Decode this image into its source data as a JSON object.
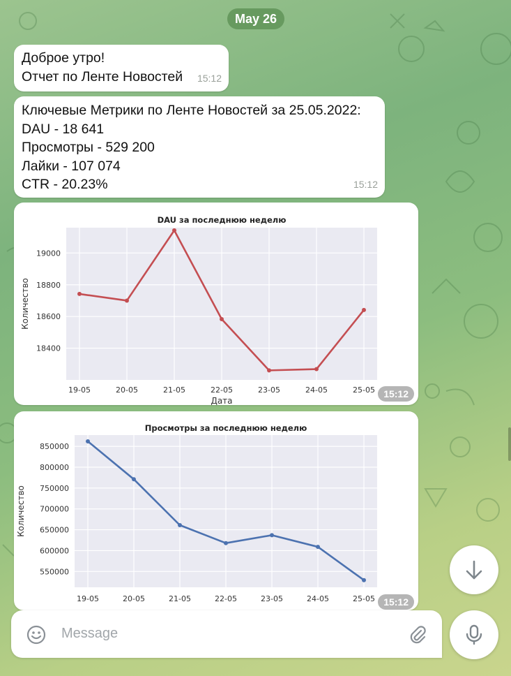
{
  "date_pill": "May 26",
  "messages": [
    {
      "lines": [
        "Доброе утро!",
        "Отчет по Ленте Новостей"
      ],
      "time": "15:12"
    },
    {
      "lines": [
        "Ключевые Метрики по Ленте Новостей за 25.05.2022:",
        "DAU - 18 641",
        "Просмотры - 529 200",
        "Лайки - 107 074",
        "CTR - 20.23%"
      ],
      "time": "15:12"
    }
  ],
  "charts": [
    {
      "time": "15:12"
    },
    {
      "time": "15:12"
    }
  ],
  "input": {
    "placeholder": "Message"
  },
  "icons": {
    "emoji": "emoji-icon",
    "attach": "paperclip-icon",
    "mic": "microphone-icon",
    "scroll_down": "arrow-down-icon"
  },
  "colors": {
    "accent_red": "#c44e52",
    "accent_blue": "#4c72b0",
    "plot_bg": "#eaeaf2"
  },
  "chart_data": [
    {
      "type": "line",
      "title": "DAU за последнюю неделю",
      "xlabel": "Дата",
      "ylabel": "Количество",
      "categories": [
        "19-05",
        "20-05",
        "21-05",
        "22-05",
        "23-05",
        "24-05",
        "25-05"
      ],
      "series": [
        {
          "values": [
            18742,
            18700,
            19143,
            18583,
            18260,
            18268,
            18641
          ],
          "color": "#c44e52"
        }
      ],
      "ylim": [
        18200,
        19160
      ],
      "yticks": [
        18400,
        18600,
        18800,
        19000
      ],
      "grid": true
    },
    {
      "type": "line",
      "title": "Просмотры за последнюю неделю",
      "xlabel": "",
      "ylabel": "Количество",
      "categories": [
        "19-05",
        "20-05",
        "21-05",
        "22-05",
        "23-05",
        "24-05",
        "25-05"
      ],
      "series": [
        {
          "values": [
            862000,
            771000,
            661000,
            618000,
            637000,
            609000,
            529200
          ],
          "color": "#4c72b0"
        }
      ],
      "ylim": [
        512000,
        877000
      ],
      "yticks": [
        550000,
        600000,
        650000,
        700000,
        750000,
        800000,
        850000
      ],
      "grid": true
    }
  ]
}
